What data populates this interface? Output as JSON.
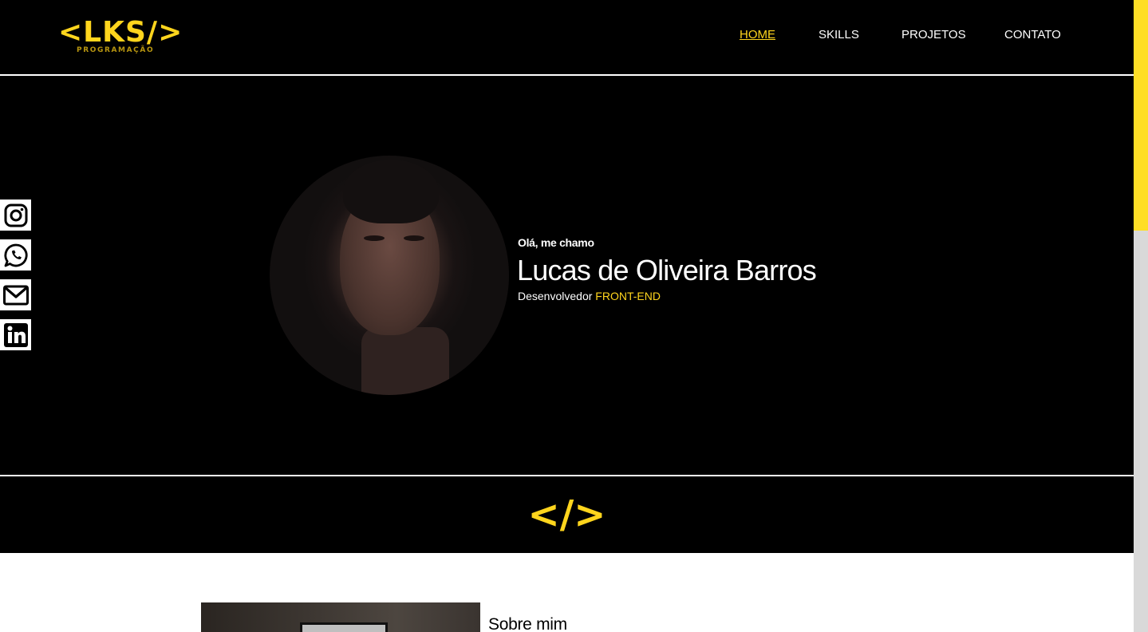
{
  "header": {
    "logo_main": "<LKS/>",
    "logo_sub": "PROGRAMAÇÃO",
    "nav": [
      {
        "label": "HOME",
        "active": true
      },
      {
        "label": "SKILLS",
        "active": false
      },
      {
        "label": "PROJETOS",
        "active": false
      },
      {
        "label": "CONTATO",
        "active": false
      }
    ]
  },
  "hero": {
    "greeting": "Olá, me chamo",
    "name": "Lucas de Oliveira Barros",
    "role_prefix": "Desenvolvedor ",
    "role_accent": "FRONT-END"
  },
  "social": [
    {
      "icon": "instagram-icon"
    },
    {
      "icon": "whatsapp-icon"
    },
    {
      "icon": "gmail-icon"
    },
    {
      "icon": "linkedin-icon"
    }
  ],
  "band": {
    "code_symbol": "</>"
  },
  "about": {
    "title": "Sobre mim"
  },
  "colors": {
    "accent": "#ffd51d",
    "background": "#000000",
    "text": "#ffffff"
  }
}
